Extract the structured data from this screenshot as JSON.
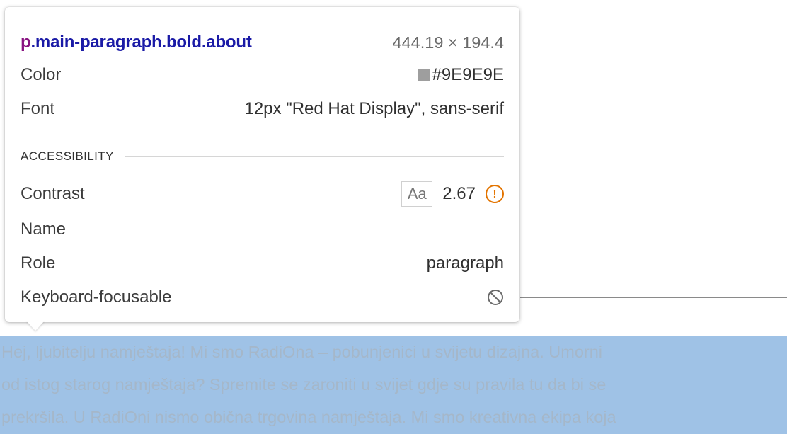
{
  "tooltip": {
    "selector_tag": "p",
    "selector_classes": ".main-paragraph.bold.about",
    "dimensions": "444.19 × 194.4",
    "color_label": "Color",
    "color_value": "#9E9E9E",
    "color_swatch": "#9E9E9E",
    "font_label": "Font",
    "font_value": "12px \"Red Hat Display\", sans-serif",
    "accessibility_title": "ACCESSIBILITY",
    "contrast_label": "Contrast",
    "contrast_sample": "Aa",
    "contrast_value": "2.67",
    "contrast_icon": "warning-icon",
    "name_label": "Name",
    "name_value": "",
    "role_label": "Role",
    "role_value": "paragraph",
    "focusable_label": "Keyboard-focusable",
    "focusable_icon": "no-entry-icon"
  },
  "paragraph": {
    "line1": "Hej, ljubitelju namještaja! Mi smo RadiOna – pobunjenici u svijetu dizajna. Umorni",
    "line2": "od istog starog namještaja? Spremite se zaroniti u svijet gdje su pravila tu da bi se",
    "line3": "prekršila. U RadiOni nismo obična trgovina namještaja. Mi smo kreativna ekipa koja"
  },
  "colors": {
    "highlight": "#9FC2E6",
    "selector_tag": "#881280",
    "selector_class": "#1A1AA6",
    "warning": "#E37400"
  }
}
